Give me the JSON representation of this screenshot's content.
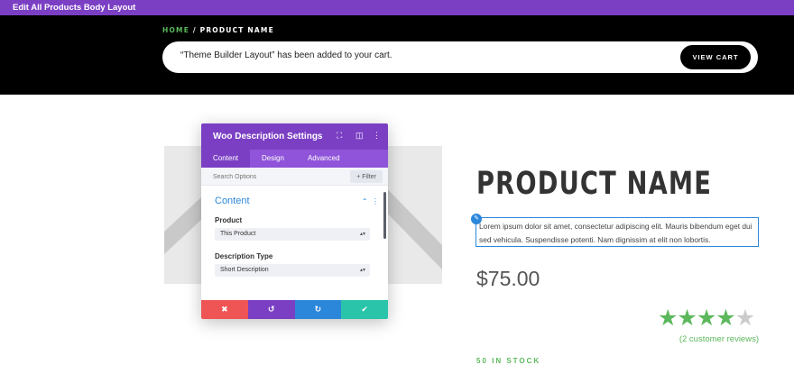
{
  "topbar": {
    "title": "Edit All Products Body Layout"
  },
  "breadcrumb": {
    "home": "HOME",
    "separator": "/",
    "current": "PRODUCT NAME"
  },
  "notice": {
    "message": "“Theme Builder Layout” has been added to your cart.",
    "button": "VIEW CART"
  },
  "product": {
    "title": "PRODUCT NAME",
    "description": "Lorem ipsum dolor sit amet, consectetur adipiscing elit. Mauris bibendum eget dui sed vehicula. Suspendisse potenti. Nam dignissim at elit non lobortis.",
    "price": "$75.00",
    "rating": {
      "value": 4,
      "max": 5
    },
    "reviews": "(2 customer reviews)",
    "stock": "50 IN STOCK"
  },
  "panel": {
    "title": "Woo Description Settings",
    "tabs": [
      "Content",
      "Design",
      "Advanced"
    ],
    "search_placeholder": "Search Options",
    "filter_label": "+ Filter",
    "section": "Content",
    "fields": [
      {
        "label": "Product",
        "value": "This Product"
      },
      {
        "label": "Description Type",
        "value": "Short Description"
      }
    ],
    "actions": {
      "cancel": "✖",
      "undo": "↺",
      "redo": "↻",
      "save": "✔"
    }
  },
  "colors": {
    "accent": "#7b3fc4",
    "blue": "#2b87da",
    "green": "#5cb85c",
    "red": "#ef5555",
    "teal": "#29c4a9"
  },
  "icons": [
    "edit-icon",
    "resize-icon",
    "columns-icon",
    "more-icon",
    "chevron-up-icon",
    "star-icon"
  ]
}
